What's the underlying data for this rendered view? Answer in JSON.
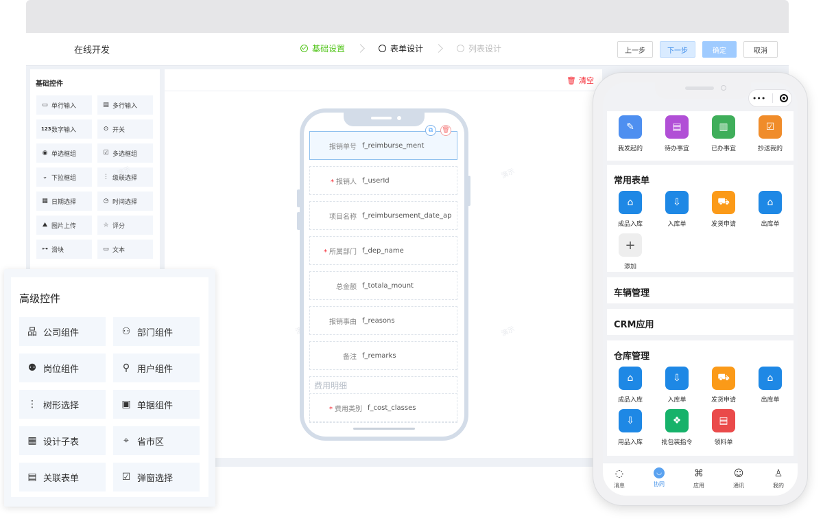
{
  "header": {
    "app_title": "在线开发",
    "steps": [
      {
        "label": "基础设置",
        "state": "done"
      },
      {
        "label": "表单设计",
        "state": "active"
      },
      {
        "label": "列表设计",
        "state": "todo"
      }
    ],
    "buttons": {
      "prev": "上一步",
      "next": "下一步",
      "confirm": "确定",
      "cancel": "取消"
    }
  },
  "basic_controls": {
    "title": "基础控件",
    "items": [
      {
        "label": "单行输入",
        "icon": "single-line-input-icon"
      },
      {
        "label": "多行输入",
        "icon": "multi-line-input-icon"
      },
      {
        "label": "数字输入",
        "icon": "number-input-icon"
      },
      {
        "label": "开关",
        "icon": "switch-icon"
      },
      {
        "label": "单选框组",
        "icon": "radio-icon"
      },
      {
        "label": "多选框组",
        "icon": "checkbox-icon"
      },
      {
        "label": "下拉框组",
        "icon": "dropdown-icon"
      },
      {
        "label": "级联选择",
        "icon": "cascade-icon"
      },
      {
        "label": "日期选择",
        "icon": "calendar-icon"
      },
      {
        "label": "时间选择",
        "icon": "clock-icon"
      },
      {
        "label": "图片上传",
        "icon": "image-upload-icon"
      },
      {
        "label": "评分",
        "icon": "star-icon"
      },
      {
        "label": "滑块",
        "icon": "slider-icon"
      },
      {
        "label": "文本",
        "icon": "text-icon"
      }
    ]
  },
  "canvas": {
    "clear_label": "清空",
    "watermark": "演示",
    "fields": [
      {
        "label": "报销单号",
        "value": "f_reimburse_ment",
        "required": false,
        "selected": true
      },
      {
        "label": "报销人",
        "value": "f_userId",
        "required": true,
        "selected": false
      },
      {
        "label": "项目名称",
        "value": "f_reimbursement_date_ap",
        "required": false,
        "selected": false
      },
      {
        "label": "所属部门",
        "value": "f_dep_name",
        "required": true,
        "selected": false
      },
      {
        "label": "总金额",
        "value": "f_totala_mount",
        "required": false,
        "selected": false
      },
      {
        "label": "报销事由",
        "value": "f_reasons",
        "required": false,
        "selected": false
      },
      {
        "label": "备注",
        "value": "f_remarks",
        "required": false,
        "selected": false
      }
    ],
    "subtable": {
      "title": "费用明细",
      "field": {
        "label": "费用类别",
        "value": "f_cost_classes",
        "required": true
      }
    }
  },
  "advanced_controls": {
    "title": "高级控件",
    "items": [
      {
        "label": "公司组件",
        "icon": "org-tree-icon"
      },
      {
        "label": "部门组件",
        "icon": "department-icon"
      },
      {
        "label": "岗位组件",
        "icon": "position-icon"
      },
      {
        "label": "用户组件",
        "icon": "user-icon"
      },
      {
        "label": "树形选择",
        "icon": "tree-select-icon"
      },
      {
        "label": "单据组件",
        "icon": "document-icon"
      },
      {
        "label": "设计子表",
        "icon": "table-icon"
      },
      {
        "label": "省市区",
        "icon": "location-icon"
      },
      {
        "label": "关联表单",
        "icon": "linked-form-icon"
      },
      {
        "label": "弹窗选择",
        "icon": "popup-select-icon"
      }
    ]
  },
  "mobile": {
    "capsule_dots": "•••",
    "top_apps": [
      {
        "label": "我发起的",
        "color": "#4e8ff0",
        "icon": "initiated-icon"
      },
      {
        "label": "待办事宜",
        "color": "#b14fd6",
        "icon": "todo-icon"
      },
      {
        "label": "已办事宜",
        "color": "#3fae5a",
        "icon": "done-icon"
      },
      {
        "label": "抄送我的",
        "color": "#f08c2a",
        "icon": "cc-icon"
      }
    ],
    "sections": [
      {
        "title": "常用表单",
        "apps": [
          {
            "label": "成品入库",
            "color": "#1e88e5",
            "icon": "warehouse-icon"
          },
          {
            "label": "入库单",
            "color": "#1e88e5",
            "icon": "inbound-icon"
          },
          {
            "label": "发货申请",
            "color": "#fb9a18",
            "icon": "truck-icon"
          },
          {
            "label": "出库单",
            "color": "#1e88e5",
            "icon": "outbound-icon"
          },
          {
            "label": "添加",
            "color": "#eeeeee",
            "icon": "plus-icon"
          }
        ]
      },
      {
        "title": "车辆管理",
        "apps": []
      },
      {
        "title": "CRM应用",
        "apps": []
      },
      {
        "title": "仓库管理",
        "apps": [
          {
            "label": "成品入库",
            "color": "#1e88e5",
            "icon": "warehouse-icon"
          },
          {
            "label": "入库单",
            "color": "#1e88e5",
            "icon": "inbound-icon"
          },
          {
            "label": "发货申请",
            "color": "#fb9a18",
            "icon": "truck-icon"
          },
          {
            "label": "出库单",
            "color": "#1e88e5",
            "icon": "outbound-icon"
          },
          {
            "label": "用品入库",
            "color": "#1e88e5",
            "icon": "supplies-icon"
          },
          {
            "label": "批包装指令",
            "color": "#16b26a",
            "icon": "package-icon"
          },
          {
            "label": "领料单",
            "color": "#ea4a4a",
            "icon": "requisition-icon"
          }
        ]
      }
    ],
    "tabs": [
      {
        "label": "消息",
        "icon": "message-icon",
        "active": false
      },
      {
        "label": "协同",
        "icon": "collab-icon",
        "active": true
      },
      {
        "label": "应用",
        "icon": "apps-icon",
        "active": false
      },
      {
        "label": "通讯",
        "icon": "contacts-icon",
        "active": false
      },
      {
        "label": "我的",
        "icon": "profile-icon",
        "active": false
      }
    ]
  },
  "colors": {
    "accent": "#409eff",
    "success": "#52c41a",
    "danger": "#f5222d"
  }
}
